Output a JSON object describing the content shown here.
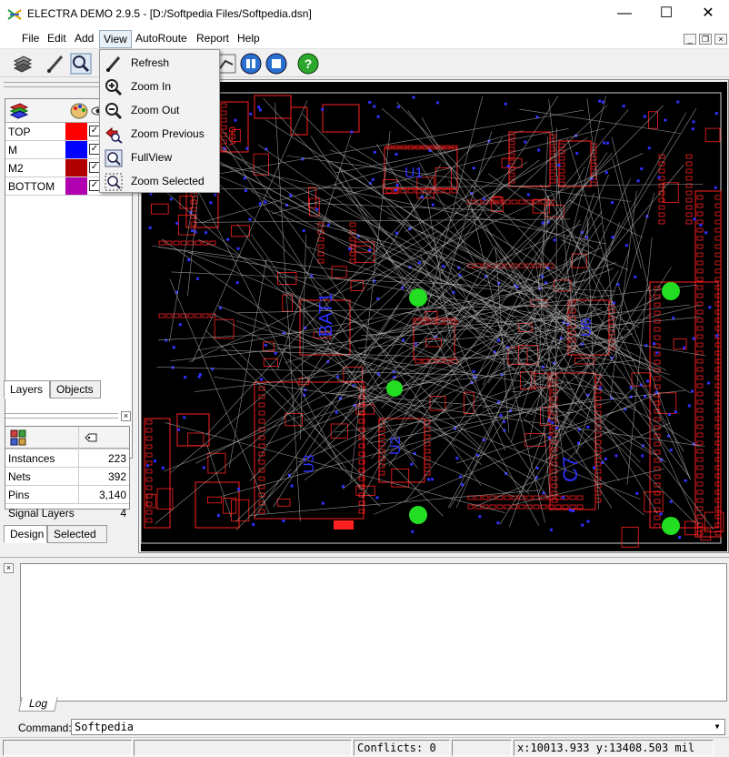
{
  "window": {
    "title": "ELECTRA DEMO 2.9.5 - [D:/Softpedia Files/Softpedia.dsn]",
    "minimize_glyph": "—",
    "maximize_glyph": "☐",
    "close_glyph": "✕"
  },
  "menubar": {
    "items": [
      "File",
      "Edit",
      "Add",
      "View",
      "AutoRoute",
      "Report",
      "Help"
    ],
    "active": "View"
  },
  "view_menu": {
    "items": [
      {
        "label": "Refresh",
        "icon": "brush-icon"
      },
      {
        "label": "Zoom In",
        "icon": "zoom-in-icon"
      },
      {
        "label": "Zoom Out",
        "icon": "zoom-out-icon"
      },
      {
        "label": "Zoom Previous",
        "icon": "zoom-previous-icon"
      },
      {
        "label": "FullView",
        "icon": "full-view-icon"
      },
      {
        "label": "Zoom Selected",
        "icon": "zoom-selected-icon"
      }
    ]
  },
  "layers": {
    "rows": [
      {
        "name": "TOP",
        "color": "#ff0000",
        "visible_mark": "✓"
      },
      {
        "name": "M",
        "color": "#0000ff",
        "visible_mark": "✓"
      },
      {
        "name": "M2",
        "color": "#b00000",
        "visible_mark": "✓"
      },
      {
        "name": "BOTTOM",
        "color": "#b000b0",
        "visible_mark": "✓"
      }
    ],
    "tabs": [
      "Layers",
      "Objects"
    ]
  },
  "stats": {
    "rows": [
      {
        "label": "Instances",
        "value": "223"
      },
      {
        "label": "Nets",
        "value": "392"
      },
      {
        "label": "Pins",
        "value": "3,140"
      },
      {
        "label": "Signal Layers",
        "value": "4"
      }
    ],
    "tabs": [
      "Design",
      "Selected"
    ]
  },
  "pcb_labels": {
    "u1": "U1",
    "bat": "BAT1",
    "u2": "U2",
    "u3": "U3",
    "u6": "U6",
    "c7": "C7",
    "vdd": "VDD"
  },
  "log": {
    "tab_label": "Log",
    "command_label": "Command:",
    "command_value": "Softpedia"
  },
  "statusbar": {
    "conflicts": "Conflicts: 0",
    "coords": "x:10013.933 y:13408.503 mil"
  },
  "colors": {
    "pcb_background": "#000000",
    "pad_red": "#ff2020",
    "via_blue": "#3030ff",
    "ratsnest": "#b0b0b0",
    "marker_green": "#22dd22"
  }
}
